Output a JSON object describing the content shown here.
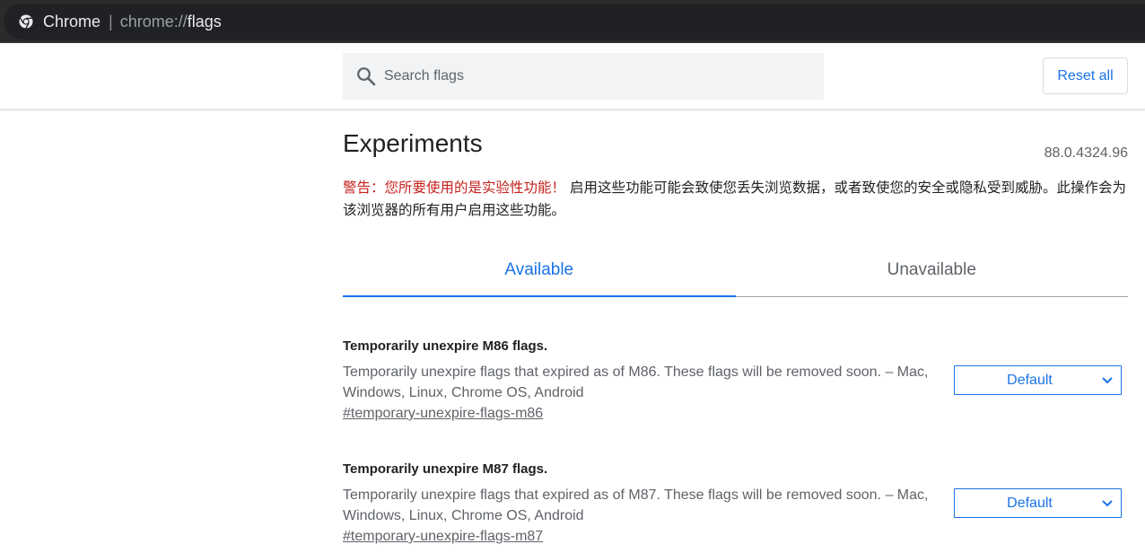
{
  "omnibox": {
    "site_name": "Chrome",
    "separator": "|",
    "url_scheme": "chrome://",
    "url_path": "flags",
    "icon": "chrome-icon"
  },
  "header": {
    "search_placeholder": "Search flags",
    "search_value": "",
    "search_icon": "search-icon",
    "reset_label": "Reset all"
  },
  "page": {
    "title": "Experiments",
    "version": "88.0.4324.96",
    "warning_strong": "警告：您所要使用的是实验性功能！",
    "warning_text": " 启用这些功能可能会致使您丢失浏览数据，或者致使您的安全或隐私受到威胁。此操作会为该浏览器的所有用户启用这些功能。"
  },
  "tabs": [
    {
      "label": "Available",
      "active": true
    },
    {
      "label": "Unavailable",
      "active": false
    }
  ],
  "flags": [
    {
      "title": "Temporarily unexpire M86 flags.",
      "description": "Temporarily unexpire flags that expired as of M86. These flags will be removed soon. – Mac, Windows, Linux, Chrome OS, Android",
      "link": "#temporary-unexpire-flags-m86",
      "selected": "Default"
    },
    {
      "title": "Temporarily unexpire M87 flags.",
      "description": "Temporarily unexpire flags that expired as of M87. These flags will be removed soon. – Mac, Windows, Linux, Chrome OS, Android",
      "link": "#temporary-unexpire-flags-m87",
      "selected": "Default"
    }
  ],
  "colors": {
    "accent": "#1a73e8",
    "warning": "#c5221f",
    "omnibox_bg": "#202124"
  }
}
